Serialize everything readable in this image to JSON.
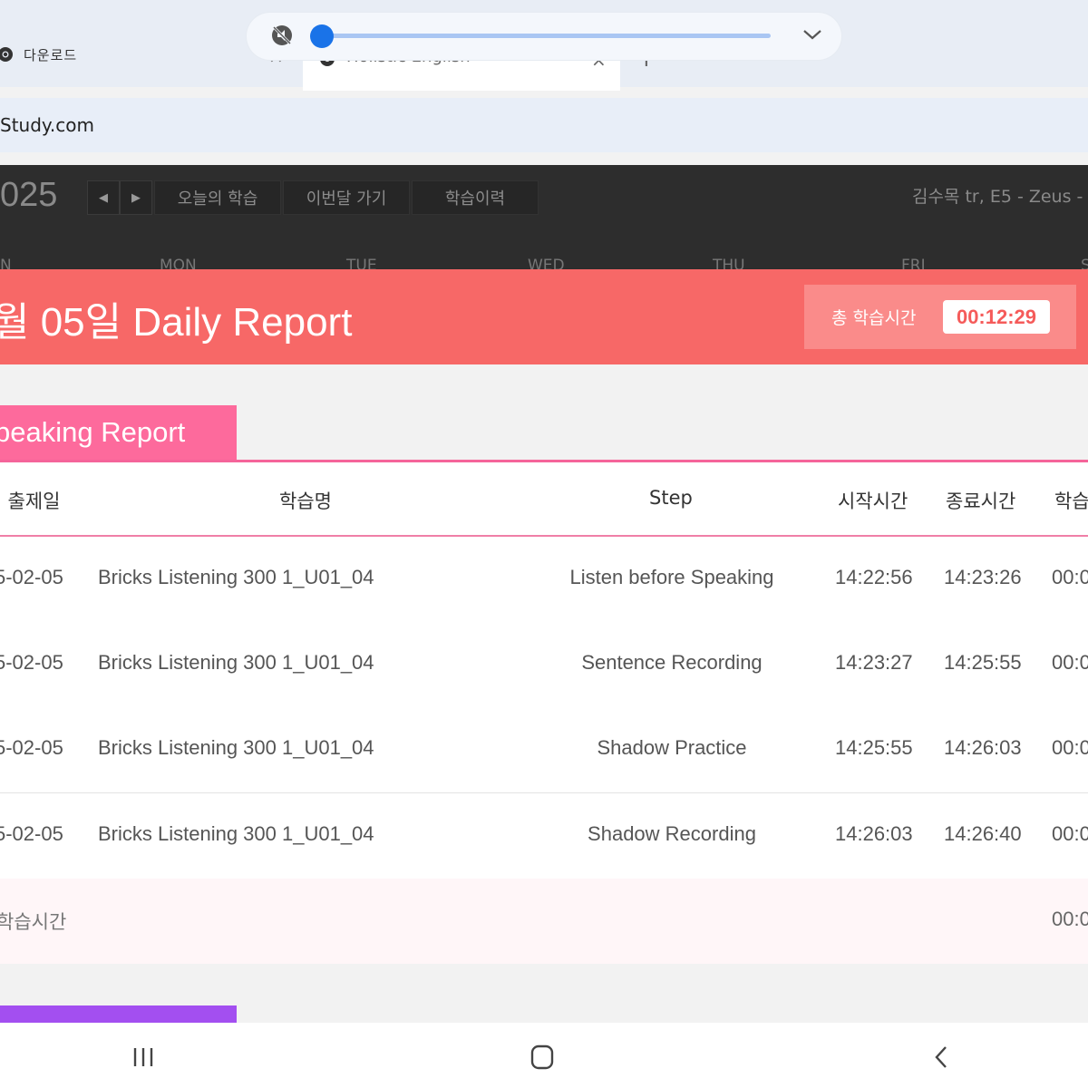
{
  "browser": {
    "tabs": [
      {
        "label": "다운로드"
      },
      {
        "label": "Holistic English"
      }
    ],
    "new_tab_label": "+",
    "close_label": "×",
    "url": "Study.com"
  },
  "header": {
    "year": "025",
    "prev": "◀",
    "next": "▶",
    "menu": [
      "오늘의 학습",
      "이번달 가기",
      "학습이력"
    ],
    "user": "김수목 tr, E5 - Zeus -",
    "weekdays": [
      "N",
      "MON",
      "TUE",
      "WED",
      "THU",
      "FRI",
      "S"
    ]
  },
  "report": {
    "title": "월 05일 Daily Report",
    "total_label": "총 학습시간",
    "total_value": "00:12:29"
  },
  "speaking": {
    "title": "peaking Report",
    "columns": [
      "l 출제일",
      "학습명",
      "Step",
      "시작시간",
      "종료시간",
      "학습"
    ],
    "rows": [
      {
        "date": "5-02-05",
        "name": "Bricks Listening 300 1_U01_04",
        "step": "Listen before Speaking",
        "start": "14:22:56",
        "end": "14:23:26",
        "dur": "00:0"
      },
      {
        "date": "5-02-05",
        "name": "Bricks Listening 300 1_U01_04",
        "step": "Sentence Recording",
        "start": "14:23:27",
        "end": "14:25:55",
        "dur": "00:0"
      },
      {
        "date": "5-02-05",
        "name": "Bricks Listening 300 1_U01_04",
        "step": "Shadow Practice",
        "start": "14:25:55",
        "end": "14:26:03",
        "dur": "00:0"
      },
      {
        "date": "5-02-05",
        "name": "Bricks Listening 300 1_U01_04",
        "step": "Shadow Recording",
        "start": "14:26:03",
        "end": "14:26:40",
        "dur": "00:0"
      }
    ],
    "total_label": "학습시간",
    "total_value": "00:0"
  },
  "media": {
    "progress": 0.0
  },
  "colors": {
    "header_bg": "#2d2d2d",
    "banner": "#f76867",
    "section_tab": "#fd6a9c",
    "next_tab": "#a34ff0",
    "accent_blue": "#1a73e8"
  }
}
